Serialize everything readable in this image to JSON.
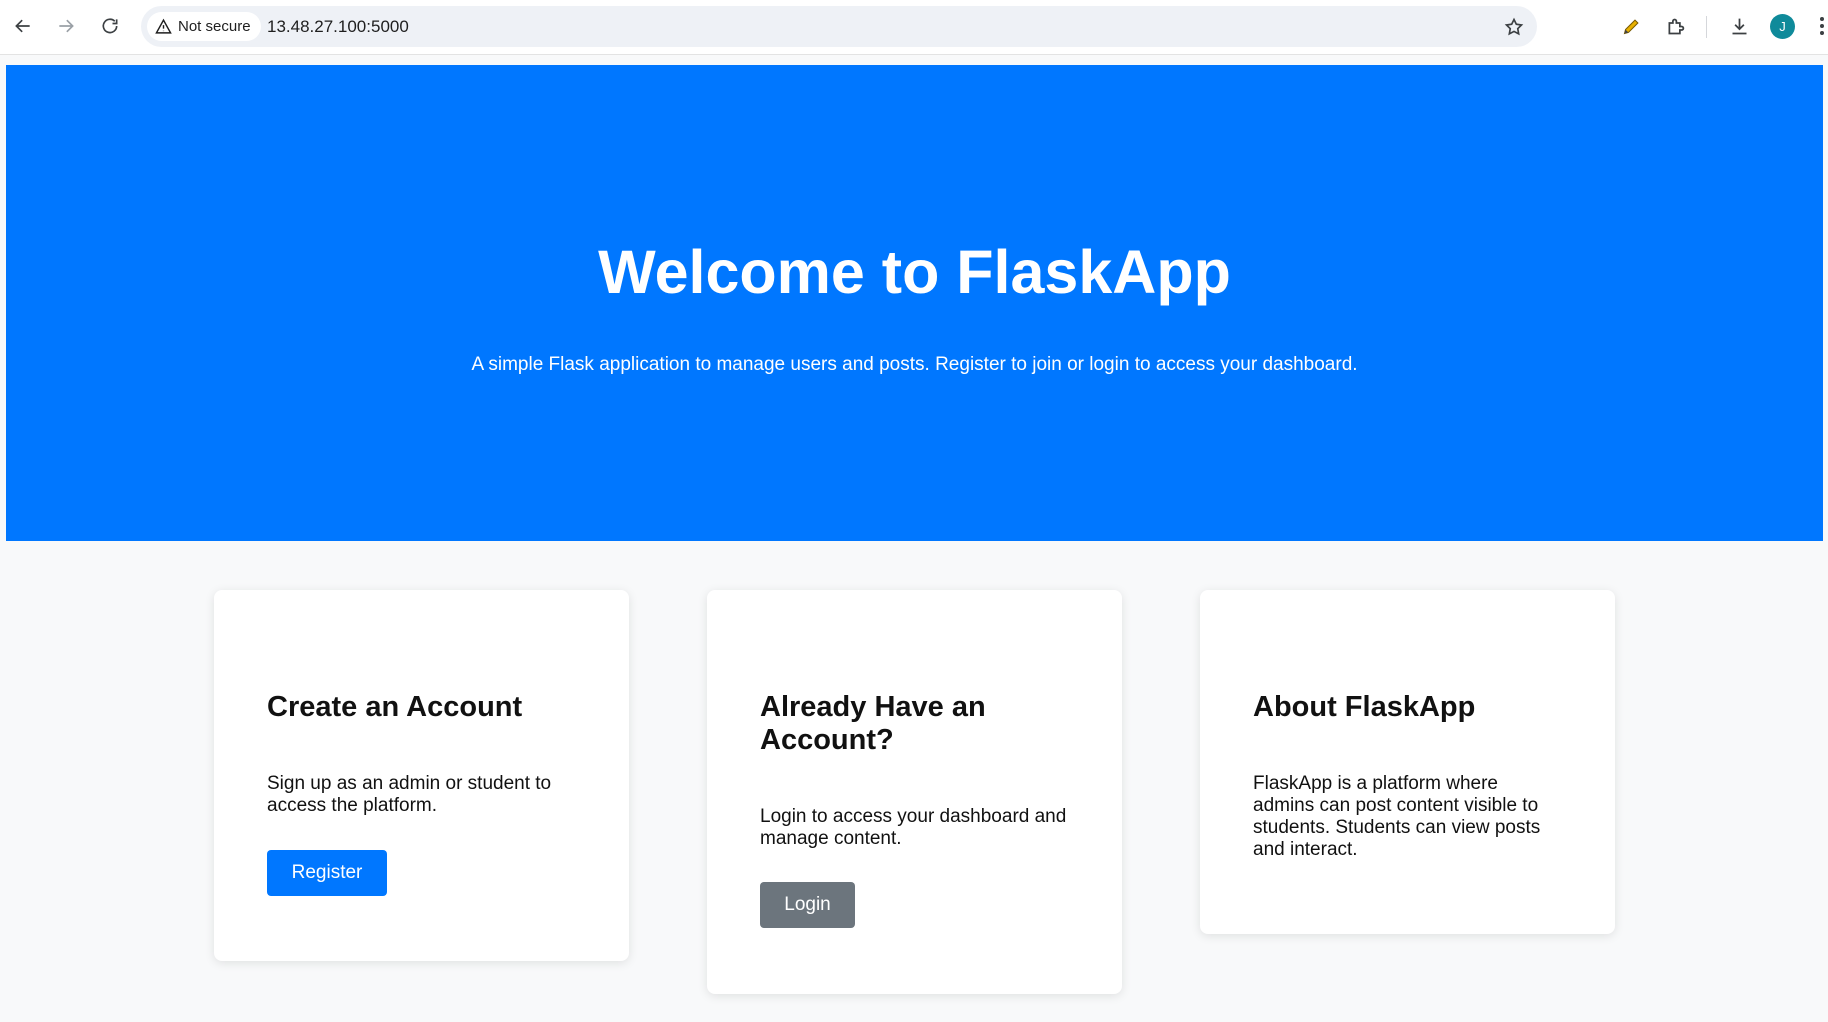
{
  "browser": {
    "security_label": "Not secure",
    "url": "13.48.27.100:5000",
    "profile_initial": "J"
  },
  "hero": {
    "title": "Welcome to FlaskApp",
    "subtitle": "A simple Flask application to manage users and posts. Register to join or login to access your dashboard."
  },
  "cards": [
    {
      "title": "Create an Account",
      "text": "Sign up as an admin or student to access the platform.",
      "button_label": "Register"
    },
    {
      "title": "Already Have an Account?",
      "text": "Login to access your dashboard and manage content.",
      "button_label": "Login"
    },
    {
      "title": "About FlaskApp",
      "text": "FlaskApp is a platform where admins can post content visible to students. Students can view posts and interact."
    }
  ],
  "colors": {
    "hero_bg": "#0077ff",
    "register_button": "#0077ff",
    "login_button": "#6c757d",
    "page_bg": "#f8f9fa"
  }
}
